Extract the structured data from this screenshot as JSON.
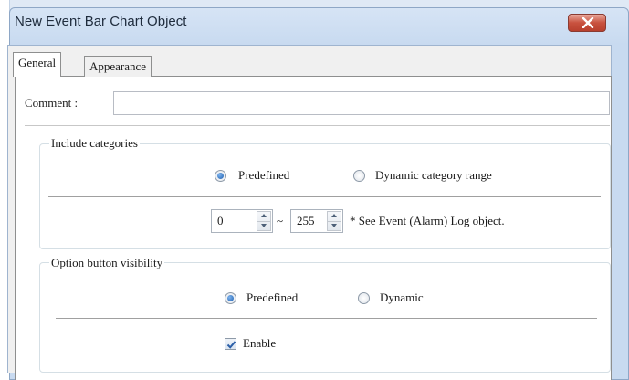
{
  "window": {
    "title": "New Event Bar Chart Object"
  },
  "tabs": [
    {
      "label": "General"
    },
    {
      "label": "Appearance"
    }
  ],
  "comment": {
    "label": "Comment :",
    "value": ""
  },
  "include_categories": {
    "legend": "Include categories",
    "options": [
      {
        "label": "Predefined",
        "selected": true
      },
      {
        "label": "Dynamic category range",
        "selected": false
      }
    ],
    "range_min": "0",
    "range_separator": "~",
    "range_max": "255",
    "note": "* See Event (Alarm) Log object."
  },
  "option_button_visibility": {
    "legend": "Option button visibility",
    "options": [
      {
        "label": "Predefined",
        "selected": true
      },
      {
        "label": "Dynamic",
        "selected": false
      }
    ],
    "enable": {
      "label": "Enable",
      "checked": true
    }
  },
  "colors": {
    "close_button": "#c9523f",
    "radio_selected": "#1d5fb0",
    "checkmark": "#2b5fa8"
  }
}
